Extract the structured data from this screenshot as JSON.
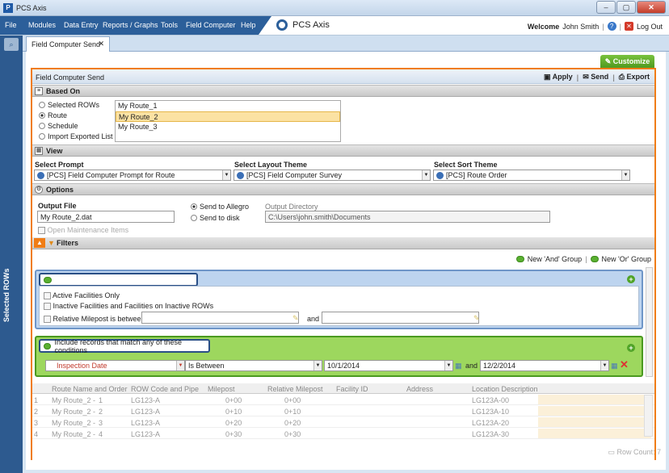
{
  "window": {
    "title": "PCS Axis",
    "app_icon": "pcs-app-icon"
  },
  "menu": {
    "items": [
      "File",
      "Modules",
      "Data Entry",
      "Reports / Graphs",
      "Tools",
      "Field Computer",
      "Help"
    ],
    "logo_text": "PCS Axis",
    "welcome_label": "Welcome",
    "user": "John Smith",
    "logout": "Log Out"
  },
  "sidebar": {
    "vertical_label": "Selected ROWs"
  },
  "tabs": [
    {
      "label": "Field Computer Send"
    }
  ],
  "toolbar": {
    "customize": "Customize"
  },
  "panel": {
    "title": "Field Computer Send",
    "apply": "Apply",
    "send": "Send",
    "export": "Export"
  },
  "based_on": {
    "title": "Based On",
    "options": [
      "Selected ROWs",
      "Route",
      "Schedule",
      "Import Exported List"
    ],
    "selected_option": "Route",
    "routes": [
      "My Route_1",
      "My Route_2",
      "My Route_3"
    ],
    "selected_route": "My Route_2"
  },
  "view": {
    "title": "View",
    "prompt_label": "Select Prompt",
    "prompt_value": "[PCS] Field Computer Prompt for Route",
    "layout_label": "Select Layout Theme",
    "layout_value": "[PCS] Field Computer Survey",
    "sort_label": "Select Sort Theme",
    "sort_value": "[PCS] Route Order"
  },
  "options": {
    "title": "Options",
    "output_file_label": "Output File",
    "output_file_value": "My Route_2.dat",
    "send_allegro": "Send to Allegro",
    "send_disk": "Send to disk",
    "selected_send": "Send to Allegro",
    "output_dir_label": "Output Directory",
    "output_dir_value": "C:\\Users\\john.smith\\Documents",
    "open_maint": "Open Maintenance Items"
  },
  "filters": {
    "title": "Filters",
    "new_and": "New 'And' Group",
    "new_or": "New 'Or' Group",
    "group1": {
      "active_only": "Active Facilities Only",
      "inactive": "Inactive Facilities and Facilities on Inactive ROWs",
      "milepost": "Relative Milepost is between",
      "and": "and"
    },
    "group2": {
      "title": "Include records that match any of these conditions",
      "field": "Inspection Date",
      "operator": "Is Between",
      "from": "10/1/2014",
      "and": "and",
      "to": "12/2/2014"
    }
  },
  "grid": {
    "columns": [
      "Route Name and Order",
      "ROW Code and Pipe",
      "Milepost",
      "Relative Milepost",
      "Facility ID",
      "Address",
      "Location Description"
    ],
    "rows": [
      {
        "n": "1",
        "route": "My Route_2 -",
        "order": "1",
        "code": "LG123-A",
        "mp": "0+00",
        "rmp": "0+00",
        "loc": "LG123A-00"
      },
      {
        "n": "2",
        "route": "My Route_2 -",
        "order": "2",
        "code": "LG123-A",
        "mp": "0+10",
        "rmp": "0+10",
        "loc": "LG123A-10"
      },
      {
        "n": "3",
        "route": "My Route_2 -",
        "order": "3",
        "code": "LG123-A",
        "mp": "0+20",
        "rmp": "0+20",
        "loc": "LG123A-20"
      },
      {
        "n": "4",
        "route": "My Route_2 -",
        "order": "4",
        "code": "LG123-A",
        "mp": "0+30",
        "rmp": "0+30",
        "loc": "LG123A-30"
      }
    ],
    "row_count_label": "Row Count: 7"
  },
  "colors": {
    "accent_orange": "#f07d16",
    "menu_blue": "#2c5f9a",
    "green": "#5ab031",
    "group_blue": "#bdd4ef"
  }
}
